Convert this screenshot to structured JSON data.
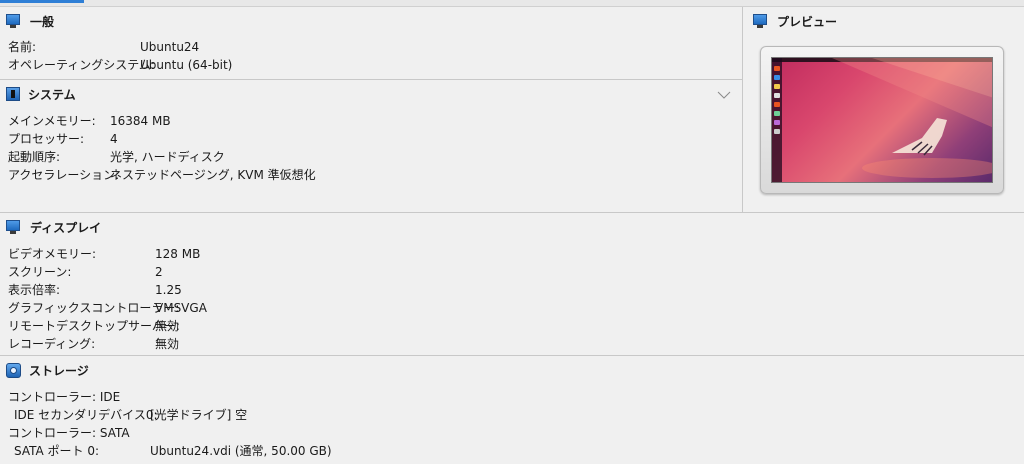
{
  "general": {
    "title": "一般",
    "rows": [
      {
        "key": "名前:",
        "value": "Ubuntu24"
      },
      {
        "key": "オペレーティングシステム:",
        "value": "Ubuntu (64-bit)"
      }
    ]
  },
  "system": {
    "title": "システム",
    "rows": [
      {
        "key": "メインメモリー:",
        "value": "16384 MB"
      },
      {
        "key": "プロセッサー:",
        "value": "4"
      },
      {
        "key": "起動順序:",
        "value": "光学, ハードディスク"
      },
      {
        "key": "アクセラレーション:",
        "value": "ネステッドページング, KVM 準仮想化"
      }
    ]
  },
  "preview": {
    "title": "プレビュー"
  },
  "display": {
    "title": "ディスプレイ",
    "rows": [
      {
        "key": "ビデオメモリー:",
        "value": "128 MB"
      },
      {
        "key": "スクリーン:",
        "value": "2"
      },
      {
        "key": "表示倍率:",
        "value": "1.25"
      },
      {
        "key": "グラフィックスコントローラー:",
        "value": "VMSVGA"
      },
      {
        "key": "リモートデスクトップサーバー:",
        "value": "無効"
      },
      {
        "key": "レコーディング:",
        "value": "無効"
      }
    ]
  },
  "storage": {
    "title": "ストレージ",
    "rows": [
      {
        "key": "コントローラー: IDE",
        "value": ""
      },
      {
        "key": "IDE セカンダリデバイス0:",
        "value": "[光学ドライブ] 空"
      },
      {
        "key": "コントローラー: SATA",
        "value": ""
      },
      {
        "key": "SATA ポート 0:",
        "value": "Ubuntu24.vdi (通常, 50.00 GB)"
      }
    ]
  },
  "colors": {
    "accent": "#2f7fd6",
    "background": "#f0f0f0"
  }
}
